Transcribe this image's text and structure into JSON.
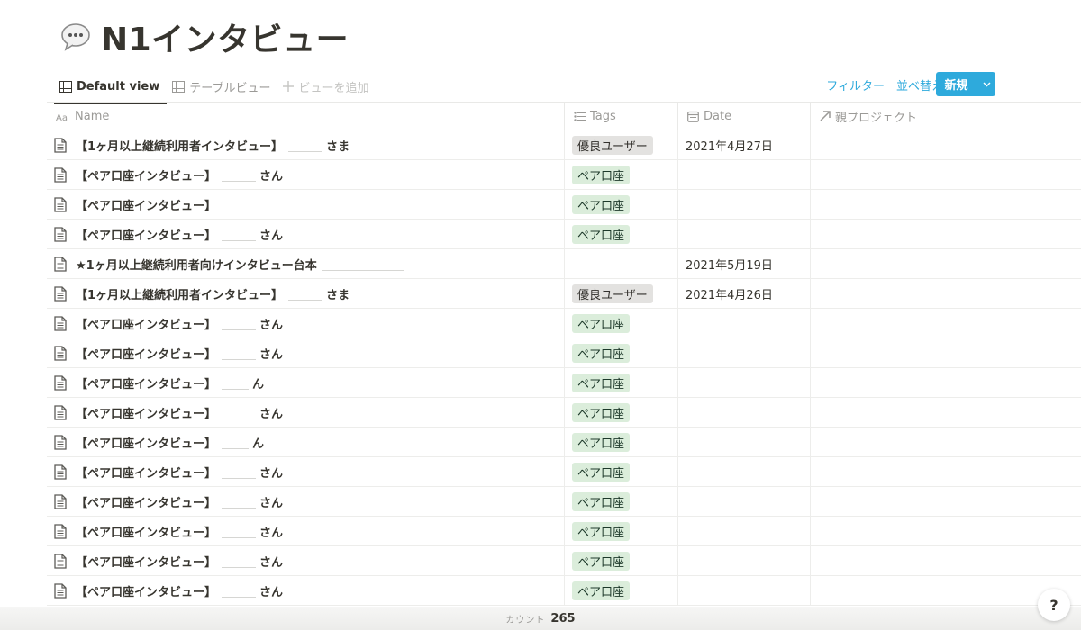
{
  "page": {
    "title": "N1インタビュー",
    "icon": "speech-bubble-icon"
  },
  "views": {
    "tabs": [
      {
        "label": "Default view",
        "icon": "table-icon",
        "active": true
      },
      {
        "label": "テーブルビュー",
        "icon": "table-icon",
        "active": false
      }
    ],
    "add_label": "ビューを追加"
  },
  "toolbar": {
    "filter_label": "フィルター",
    "sort_label": "並べ替え",
    "new_label": "新規"
  },
  "columns": [
    {
      "label": "Name",
      "icon": "text-icon"
    },
    {
      "label": "Tags",
      "icon": "list-icon"
    },
    {
      "label": "Date",
      "icon": "calendar-icon"
    },
    {
      "label": "親プロジェクト",
      "icon": "relation-arrow-icon"
    }
  ],
  "rows": [
    {
      "title": "【1ヶ月以上継続利用者インタビュー】",
      "suffix": "さま",
      "tag": "優良ユーザー",
      "tag_color": "gray",
      "date": "2021年4月27日"
    },
    {
      "title": "【ペア口座インタビュー】",
      "suffix": "さん",
      "tag": "ペア口座",
      "tag_color": "green",
      "date": ""
    },
    {
      "title": "【ペア口座インタビュー】",
      "suffix": "",
      "tag": "ペア口座",
      "tag_color": "green",
      "date": ""
    },
    {
      "title": "【ペア口座インタビュー】",
      "suffix": "さん",
      "tag": "ペア口座",
      "tag_color": "green",
      "date": ""
    },
    {
      "title": "★1ヶ月以上継続利用者向けインタビュー台本",
      "suffix": "",
      "tag": "",
      "tag_color": "",
      "date": "2021年5月19日"
    },
    {
      "title": "【1ヶ月以上継続利用者インタビュー】",
      "suffix": "さま",
      "tag": "優良ユーザー",
      "tag_color": "gray",
      "date": "2021年4月26日"
    },
    {
      "title": "【ペア口座インタビュー】",
      "suffix": "さん",
      "tag": "ペア口座",
      "tag_color": "green",
      "date": ""
    },
    {
      "title": "【ペア口座インタビュー】",
      "suffix": "さん",
      "tag": "ペア口座",
      "tag_color": "green",
      "date": ""
    },
    {
      "title": "【ペア口座インタビュー】",
      "suffix": "ん",
      "tag": "ペア口座",
      "tag_color": "green",
      "date": ""
    },
    {
      "title": "【ペア口座インタビュー】",
      "suffix": "さん",
      "tag": "ペア口座",
      "tag_color": "green",
      "date": ""
    },
    {
      "title": "【ペア口座インタビュー】",
      "suffix": "ん",
      "tag": "ペア口座",
      "tag_color": "green",
      "date": ""
    },
    {
      "title": "【ペア口座インタビュー】",
      "suffix": "さん",
      "tag": "ペア口座",
      "tag_color": "green",
      "date": ""
    },
    {
      "title": "【ペア口座インタビュー】",
      "suffix": "さん",
      "tag": "ペア口座",
      "tag_color": "green",
      "date": ""
    },
    {
      "title": "【ペア口座インタビュー】",
      "suffix": "さん",
      "tag": "ペア口座",
      "tag_color": "green",
      "date": ""
    },
    {
      "title": "【ペア口座インタビュー】",
      "suffix": "さん",
      "tag": "ペア口座",
      "tag_color": "green",
      "date": ""
    },
    {
      "title": "【ペア口座インタビュー】",
      "suffix": "さん",
      "tag": "ペア口座",
      "tag_color": "green",
      "date": ""
    }
  ],
  "footer": {
    "count_label": "カウント",
    "count_value": "265"
  },
  "help": {
    "label": "?"
  }
}
